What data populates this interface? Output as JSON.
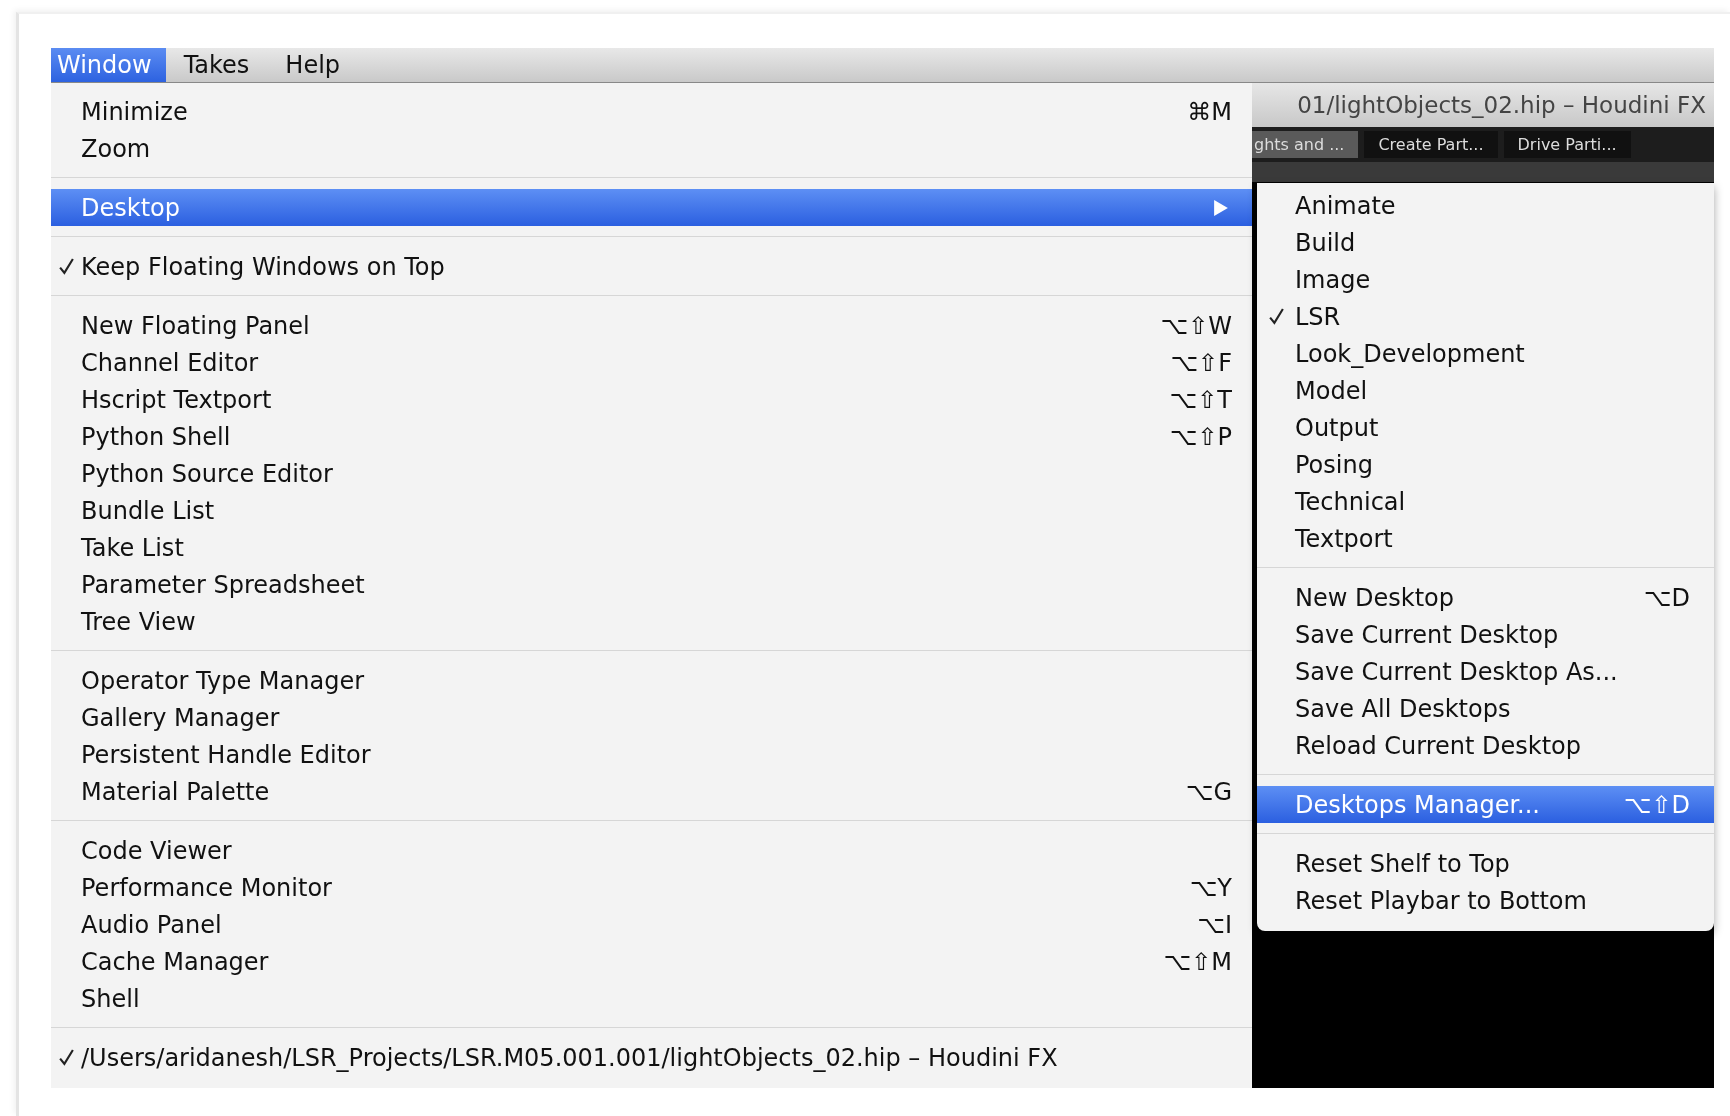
{
  "menu_bar": [
    {
      "label": "Window",
      "selected": true
    },
    {
      "label": "Takes",
      "selected": false
    },
    {
      "label": "Help",
      "selected": false
    }
  ],
  "background_window": {
    "title": "01/lightObjects_02.hip – Houdini FX",
    "tabs": [
      {
        "label": "ghts and ...",
        "selected": true
      },
      {
        "label": "Create Part...",
        "selected": false
      },
      {
        "label": "Drive Parti...",
        "selected": false
      }
    ]
  },
  "menu": {
    "groups": [
      {
        "items": [
          {
            "label": "Minimize",
            "shortcut": "⌘M",
            "checked": false,
            "selected": false
          },
          {
            "label": "Zoom",
            "checked": false,
            "selected": false
          }
        ]
      },
      {
        "items": [
          {
            "label": "Desktop",
            "checked": false,
            "selected": true,
            "submenu": true
          }
        ]
      },
      {
        "items": [
          {
            "label": "Keep Floating Windows on Top",
            "checked": true,
            "selected": false
          }
        ]
      },
      {
        "items": [
          {
            "label": "New Floating Panel",
            "shortcut": "⌥⇧W",
            "checked": false,
            "selected": false
          },
          {
            "label": "Channel Editor",
            "shortcut": "⌥⇧F",
            "checked": false,
            "selected": false
          },
          {
            "label": "Hscript Textport",
            "shortcut": "⌥⇧T",
            "checked": false,
            "selected": false
          },
          {
            "label": "Python Shell",
            "shortcut": "⌥⇧P",
            "checked": false,
            "selected": false
          },
          {
            "label": "Python Source Editor",
            "checked": false,
            "selected": false
          },
          {
            "label": "Bundle List",
            "checked": false,
            "selected": false
          },
          {
            "label": "Take List",
            "checked": false,
            "selected": false
          },
          {
            "label": "Parameter Spreadsheet",
            "checked": false,
            "selected": false
          },
          {
            "label": "Tree View",
            "checked": false,
            "selected": false
          }
        ]
      },
      {
        "items": [
          {
            "label": "Operator Type Manager",
            "checked": false,
            "selected": false
          },
          {
            "label": "Gallery Manager",
            "checked": false,
            "selected": false
          },
          {
            "label": "Persistent Handle Editor",
            "checked": false,
            "selected": false
          },
          {
            "label": "Material Palette",
            "shortcut": "⌥G",
            "checked": false,
            "selected": false
          }
        ]
      },
      {
        "items": [
          {
            "label": "Code Viewer",
            "checked": false,
            "selected": false
          },
          {
            "label": "Performance Monitor",
            "shortcut": "⌥Y",
            "checked": false,
            "selected": false
          },
          {
            "label": "Audio Panel",
            "shortcut": "⌥I",
            "checked": false,
            "selected": false
          },
          {
            "label": "Cache Manager",
            "shortcut": "⌥⇧M",
            "checked": false,
            "selected": false
          },
          {
            "label": "Shell",
            "checked": false,
            "selected": false
          }
        ]
      },
      {
        "items": [
          {
            "label": "/Users/aridanesh/LSR_Projects/LSR.M05.001.001/lightObjects_02.hip – Houdini FX",
            "checked": true,
            "selected": false
          }
        ]
      }
    ]
  },
  "desktop_submenu": {
    "groups": [
      {
        "items": [
          {
            "label": "Animate",
            "checked": false,
            "selected": false
          },
          {
            "label": "Build",
            "checked": false,
            "selected": false
          },
          {
            "label": "Image",
            "checked": false,
            "selected": false
          },
          {
            "label": "LSR",
            "checked": true,
            "selected": false
          },
          {
            "label": "Look_Development",
            "checked": false,
            "selected": false
          },
          {
            "label": "Model",
            "checked": false,
            "selected": false
          },
          {
            "label": "Output",
            "checked": false,
            "selected": false
          },
          {
            "label": "Posing",
            "checked": false,
            "selected": false
          },
          {
            "label": "Technical",
            "checked": false,
            "selected": false
          },
          {
            "label": "Textport",
            "checked": false,
            "selected": false
          }
        ]
      },
      {
        "items": [
          {
            "label": "New Desktop",
            "shortcut": "⌥D",
            "checked": false,
            "selected": false
          },
          {
            "label": "Save Current Desktop",
            "checked": false,
            "selected": false
          },
          {
            "label": "Save Current Desktop As...",
            "checked": false,
            "selected": false
          },
          {
            "label": "Save All Desktops",
            "checked": false,
            "selected": false
          },
          {
            "label": "Reload Current Desktop",
            "checked": false,
            "selected": false
          }
        ]
      },
      {
        "items": [
          {
            "label": "Desktops Manager...",
            "shortcut": "⌥⇧D",
            "checked": false,
            "selected": true
          }
        ]
      },
      {
        "items": [
          {
            "label": "Reset Shelf to Top",
            "checked": false,
            "selected": false
          },
          {
            "label": "Reset Playbar to Bottom",
            "checked": false,
            "selected": false
          }
        ]
      }
    ]
  }
}
